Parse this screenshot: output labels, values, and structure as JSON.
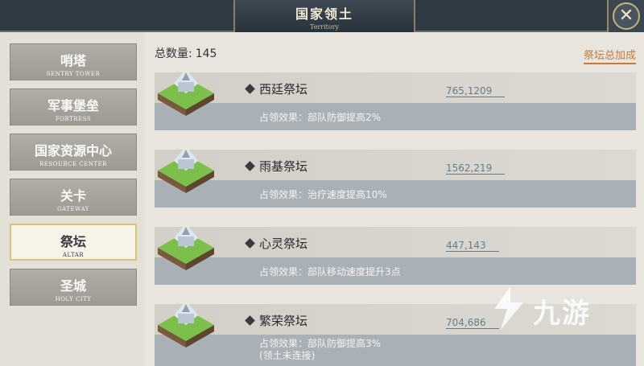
{
  "header": {
    "title_cn": "国家领土",
    "title_en": "Territory"
  },
  "sidebar": {
    "items": [
      {
        "cn": "哨塔",
        "en": "SENTRY TOWER"
      },
      {
        "cn": "军事堡垒",
        "en": "FORTRESS"
      },
      {
        "cn": "国家资源中心",
        "en": "RESOURCE CENTER"
      },
      {
        "cn": "关卡",
        "en": "GATEWAY"
      },
      {
        "cn": "祭坛",
        "en": "ALTAR"
      },
      {
        "cn": "圣城",
        "en": "HOLY CITY"
      }
    ],
    "active_index": 4
  },
  "main": {
    "total_label": "总数量:",
    "total_value": "145",
    "bonus_link": "祭坛总加成",
    "cards": [
      {
        "name": "西廷祭坛",
        "value": "765,1209",
        "effect": "占领效果：部队防御提高2%",
        "note": ""
      },
      {
        "name": "雨基祭坛",
        "value": "1562,219",
        "effect": "占领效果：治疗速度提高10%",
        "note": ""
      },
      {
        "name": "心灵祭坛",
        "value": "447,143",
        "effect": "占领效果：部队移动速度提升3点",
        "note": ""
      },
      {
        "name": "繁荣祭坛",
        "value": "704,686",
        "effect": "占领效果：部队防御提高3%",
        "note": "(领土未连接)"
      }
    ]
  },
  "watermark": {
    "text": "九游"
  },
  "colors": {
    "accent": "#c77a3c",
    "active_border": "#d9c27e",
    "header_bg": "#2f3a44"
  }
}
